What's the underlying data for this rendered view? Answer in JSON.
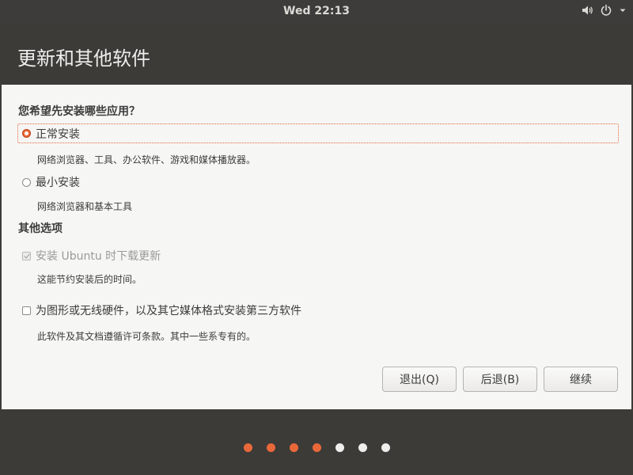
{
  "topbar": {
    "clock": "Wed 22:13",
    "volume_icon": "volume-icon",
    "power_icon": "power-icon"
  },
  "window": {
    "title": "更新和其他软件"
  },
  "install_type": {
    "question": "您希望先安装哪些应用？",
    "options": [
      {
        "label": "正常安装",
        "description": "网络浏览器、工具、办公软件、游戏和媒体播放器。",
        "selected": true
      },
      {
        "label": "最小安装",
        "description": "网络浏览器和基本工具",
        "selected": false
      }
    ]
  },
  "other_options": {
    "heading": "其他选项",
    "items": [
      {
        "label": "安装 Ubuntu 时下载更新",
        "description": "这能节约安装后的时间。",
        "checked": true,
        "disabled": true
      },
      {
        "label": "为图形或无线硬件，以及其它媒体格式安装第三方软件",
        "description": "此软件及其文档遵循许可条款。其中一些系专有的。",
        "checked": false,
        "disabled": false
      }
    ]
  },
  "buttons": {
    "quit": "退出(Q)",
    "back": "后退(B)",
    "continue": "继续"
  },
  "progress": {
    "total_steps": 7,
    "completed_steps": 4,
    "active_color": "#e9683a",
    "inactive_color": "#eeeeec"
  }
}
